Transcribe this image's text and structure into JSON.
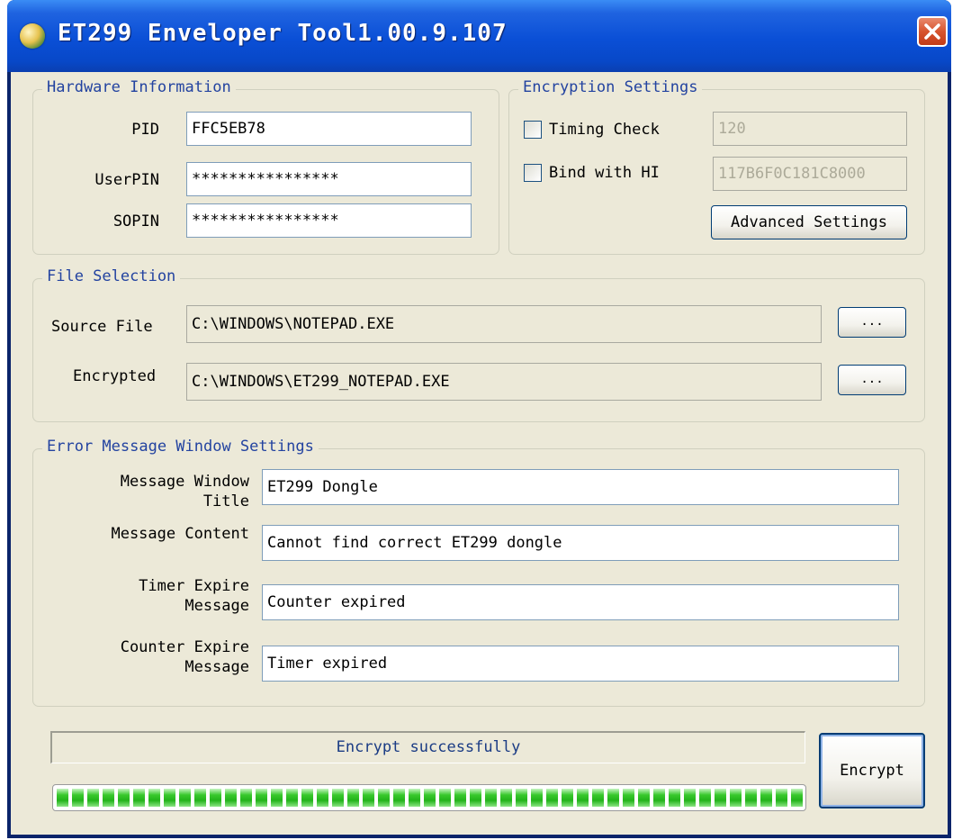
{
  "window": {
    "title": "ET299 Enveloper Tool1.00.9.107"
  },
  "hardware": {
    "legend": "Hardware Information",
    "pid_label": "PID",
    "pid_value": "FFC5EB78",
    "userpin_label": "UserPIN",
    "userpin_value": "****************",
    "sopin_label": "SOPIN",
    "sopin_value": "****************"
  },
  "encryption": {
    "legend": "Encryption Settings",
    "timing_label": "Timing Check",
    "timing_checked": false,
    "timing_value": "120",
    "bind_label": "Bind with HI",
    "bind_checked": false,
    "bind_value": "117B6F0C181C8000",
    "advanced_label": "Advanced Settings"
  },
  "files": {
    "legend": "File Selection",
    "source_label": "Source File",
    "source_value": "C:\\WINDOWS\\NOTEPAD.EXE",
    "encrypted_label": "Encrypted",
    "encrypted_value": "C:\\WINDOWS\\ET299_NOTEPAD.EXE",
    "browse_label": "..."
  },
  "errors": {
    "legend": "Error Message Window Settings",
    "title_label_1": "Message Window",
    "title_label_2": "Title",
    "title_value": "ET299 Dongle",
    "content_label": "Message Content",
    "content_value": "Cannot find correct ET299 dongle",
    "timer_label_1": "Timer Expire",
    "timer_label_2": "Message",
    "timer_value": "Counter expired",
    "counter_label_1": "Counter Expire",
    "counter_label_2": "Message",
    "counter_value": "Timer expired"
  },
  "status": {
    "message": "Encrypt successfully",
    "progress": 1.0,
    "encrypt_label": "Encrypt"
  },
  "colors": {
    "accent": "#0a4fd6",
    "legend_text": "#2343a0",
    "progress_green": "#23b31a",
    "close_red": "#d7542e"
  }
}
